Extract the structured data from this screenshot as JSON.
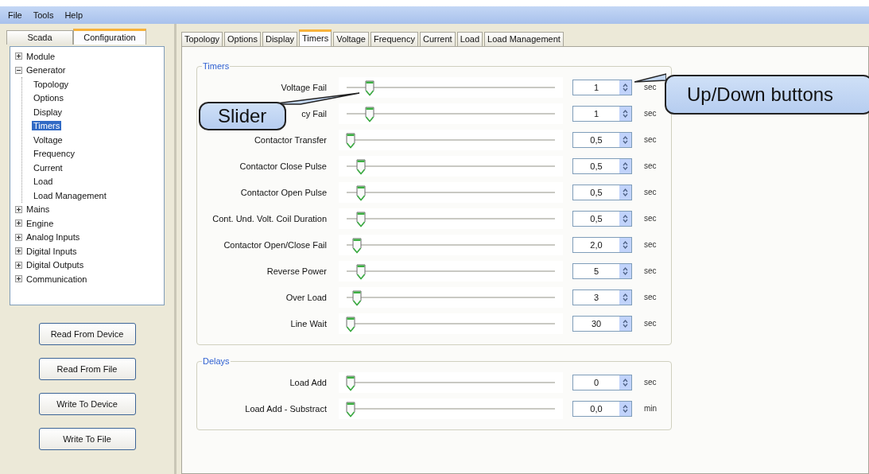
{
  "menu": [
    "File",
    "Tools",
    "Help"
  ],
  "side_tabs": [
    {
      "label": "Scada",
      "selected": false
    },
    {
      "label": "Configuration",
      "selected": true
    }
  ],
  "tree": [
    {
      "label": "Module",
      "expanded": false
    },
    {
      "label": "Generator",
      "expanded": true,
      "children": [
        {
          "label": "Topology",
          "selected": false
        },
        {
          "label": "Options",
          "selected": false
        },
        {
          "label": "Display",
          "selected": false
        },
        {
          "label": "Timers",
          "selected": true
        },
        {
          "label": "Voltage",
          "selected": false
        },
        {
          "label": "Frequency",
          "selected": false
        },
        {
          "label": "Current",
          "selected": false
        },
        {
          "label": "Load",
          "selected": false
        },
        {
          "label": "Load Management",
          "selected": false
        }
      ]
    },
    {
      "label": "Mains",
      "expanded": false
    },
    {
      "label": "Engine",
      "expanded": false
    },
    {
      "label": "Analog Inputs",
      "expanded": false
    },
    {
      "label": "Digital Inputs",
      "expanded": false
    },
    {
      "label": "Digital Outputs",
      "expanded": false
    },
    {
      "label": "Communication",
      "expanded": false
    }
  ],
  "side_buttons": [
    "Read From Device",
    "Read From File",
    "Write To Device",
    "Write To File"
  ],
  "tabs": [
    {
      "label": "Topology",
      "selected": false
    },
    {
      "label": "Options",
      "selected": false
    },
    {
      "label": "Display",
      "selected": false
    },
    {
      "label": "Timers",
      "selected": true
    },
    {
      "label": "Voltage",
      "selected": false
    },
    {
      "label": "Frequency",
      "selected": false
    },
    {
      "label": "Current",
      "selected": false
    },
    {
      "label": "Load",
      "selected": false
    },
    {
      "label": "Load Management",
      "selected": false
    }
  ],
  "groups": [
    {
      "title": "Timers",
      "rows": [
        {
          "label": "Voltage Fail",
          "level": 0.11,
          "value": "1",
          "unit": "sec"
        },
        {
          "label": "cy Fail",
          "level": 0.11,
          "value": "1",
          "unit": "sec"
        },
        {
          "label": "Contactor Transfer",
          "level": 0.02,
          "value": "0,5",
          "unit": "sec"
        },
        {
          "label": "Contactor Close Pulse",
          "level": 0.07,
          "value": "0,5",
          "unit": "sec"
        },
        {
          "label": "Contactor Open Pulse",
          "level": 0.07,
          "value": "0,5",
          "unit": "sec"
        },
        {
          "label": "Cont. Und. Volt. Coil Duration",
          "level": 0.07,
          "value": "0,5",
          "unit": "sec"
        },
        {
          "label": "Contactor Open/Close Fail",
          "level": 0.05,
          "value": "2,0",
          "unit": "sec"
        },
        {
          "label": "Reverse Power",
          "level": 0.07,
          "value": "5",
          "unit": "sec"
        },
        {
          "label": "Over Load",
          "level": 0.05,
          "value": "3",
          "unit": "sec"
        },
        {
          "label": "Line Wait",
          "level": 0.02,
          "value": "30",
          "unit": "sec"
        }
      ]
    },
    {
      "title": "Delays",
      "rows": [
        {
          "label": "Load Add",
          "level": 0.02,
          "value": "0",
          "unit": "sec"
        },
        {
          "label": "Load Add - Substract",
          "level": 0.02,
          "value": "0,0",
          "unit": "min"
        }
      ]
    }
  ],
  "callouts": [
    {
      "kind": "left",
      "text": "Slider"
    },
    {
      "kind": "right",
      "text": "Up/Down buttons"
    }
  ]
}
